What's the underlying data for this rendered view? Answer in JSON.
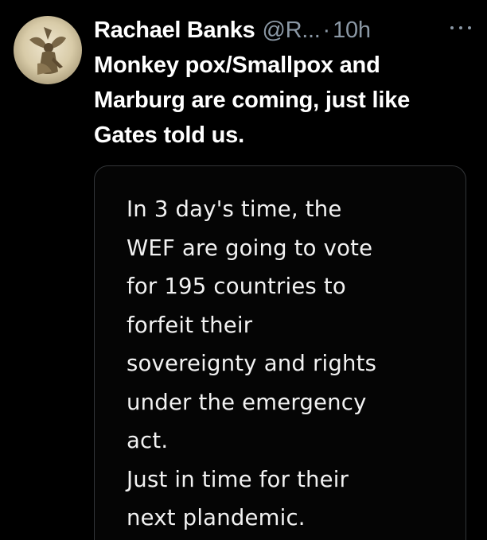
{
  "tweet": {
    "display_name": "Rachael Banks",
    "handle": "@R...",
    "separator": "·",
    "time": "10h",
    "text": "Monkey pox/Smallpox and Marburg are coming, just like Gates told us.",
    "avatar_icon": "angel-statue-avatar",
    "more_icon": "more-options-icon"
  },
  "media": {
    "text": "In 3 day's time, the\nWEF are going to vote\nfor 195 countries to\nforfeit their\nsovereignty and rights\nunder the emergency\nact.\nJust in time for their\nnext plandemic."
  },
  "colors": {
    "background": "#000000",
    "primary_text": "#ffffff",
    "secondary_text": "#8b98a5",
    "card_border": "#333639"
  }
}
